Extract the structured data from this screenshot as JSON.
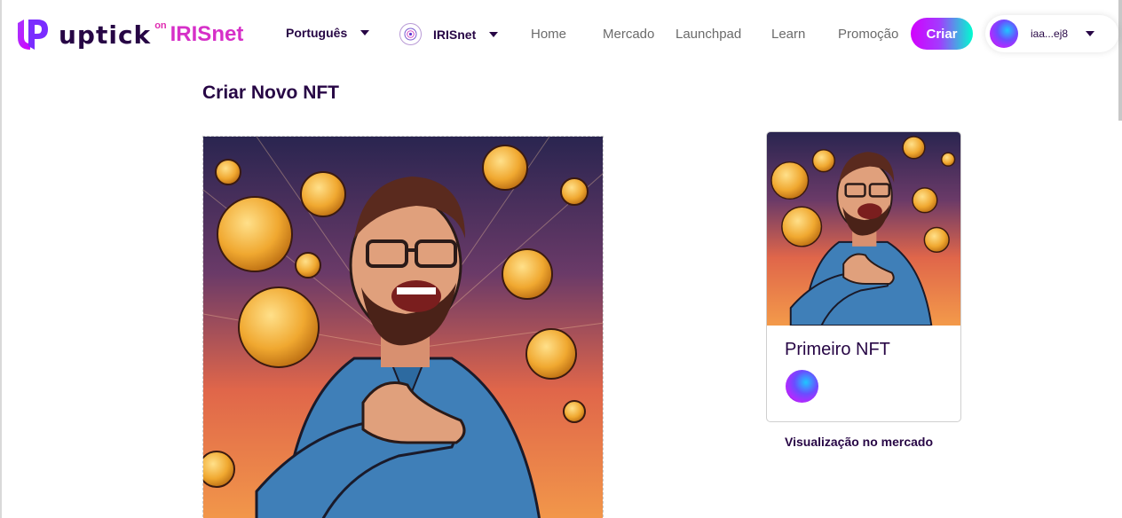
{
  "header": {
    "logo_text": "uptick",
    "logo_on": "on",
    "logo_chain": "IRISnet",
    "language": "Português",
    "chain": "IRISnet",
    "nav": [
      "Home",
      "Mercado",
      "Launchpad",
      "Learn",
      "Promoção"
    ],
    "create_label": "Criar",
    "account_label": "iaa...ej8"
  },
  "page": {
    "title": "Criar Novo NFT"
  },
  "preview": {
    "nft_name": "Primeiro NFT",
    "label": "Visualização no mercado"
  },
  "colors": {
    "brand": "#270645",
    "accent": "#d300fd",
    "accent_end": "#00fdcf",
    "iris": "#d630c8"
  }
}
